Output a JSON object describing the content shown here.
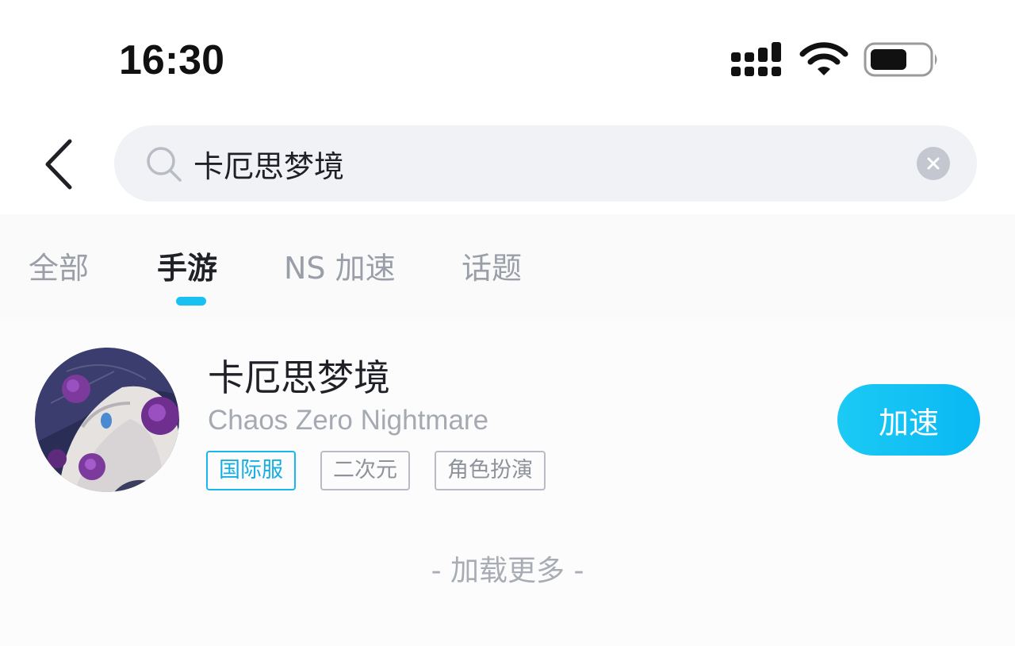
{
  "status_bar": {
    "time": "16:30"
  },
  "search": {
    "query": "卡厄思梦境",
    "back_icon": "chevron-left-icon",
    "search_icon": "magnifier-icon",
    "clear_icon": "close-circle-icon"
  },
  "tabs": [
    {
      "label": "全部",
      "active": false
    },
    {
      "label": "手游",
      "active": true
    },
    {
      "label": "NS 加速",
      "active": false
    },
    {
      "label": "话题",
      "active": false
    }
  ],
  "result": {
    "title": "卡厄思梦境",
    "subtitle": "Chaos Zero Nightmare",
    "tags": [
      {
        "label": "国际服",
        "highlighted": true
      },
      {
        "label": "二次元",
        "highlighted": false
      },
      {
        "label": "角色扮演",
        "highlighted": false
      }
    ],
    "action_label": "加速"
  },
  "load_more": "- 加载更多 -",
  "colors": {
    "accent": "#18C1F2",
    "tag_accent": "#14AEE5",
    "muted_text": "#A5A9B2",
    "search_bg": "#F1F2F5"
  }
}
